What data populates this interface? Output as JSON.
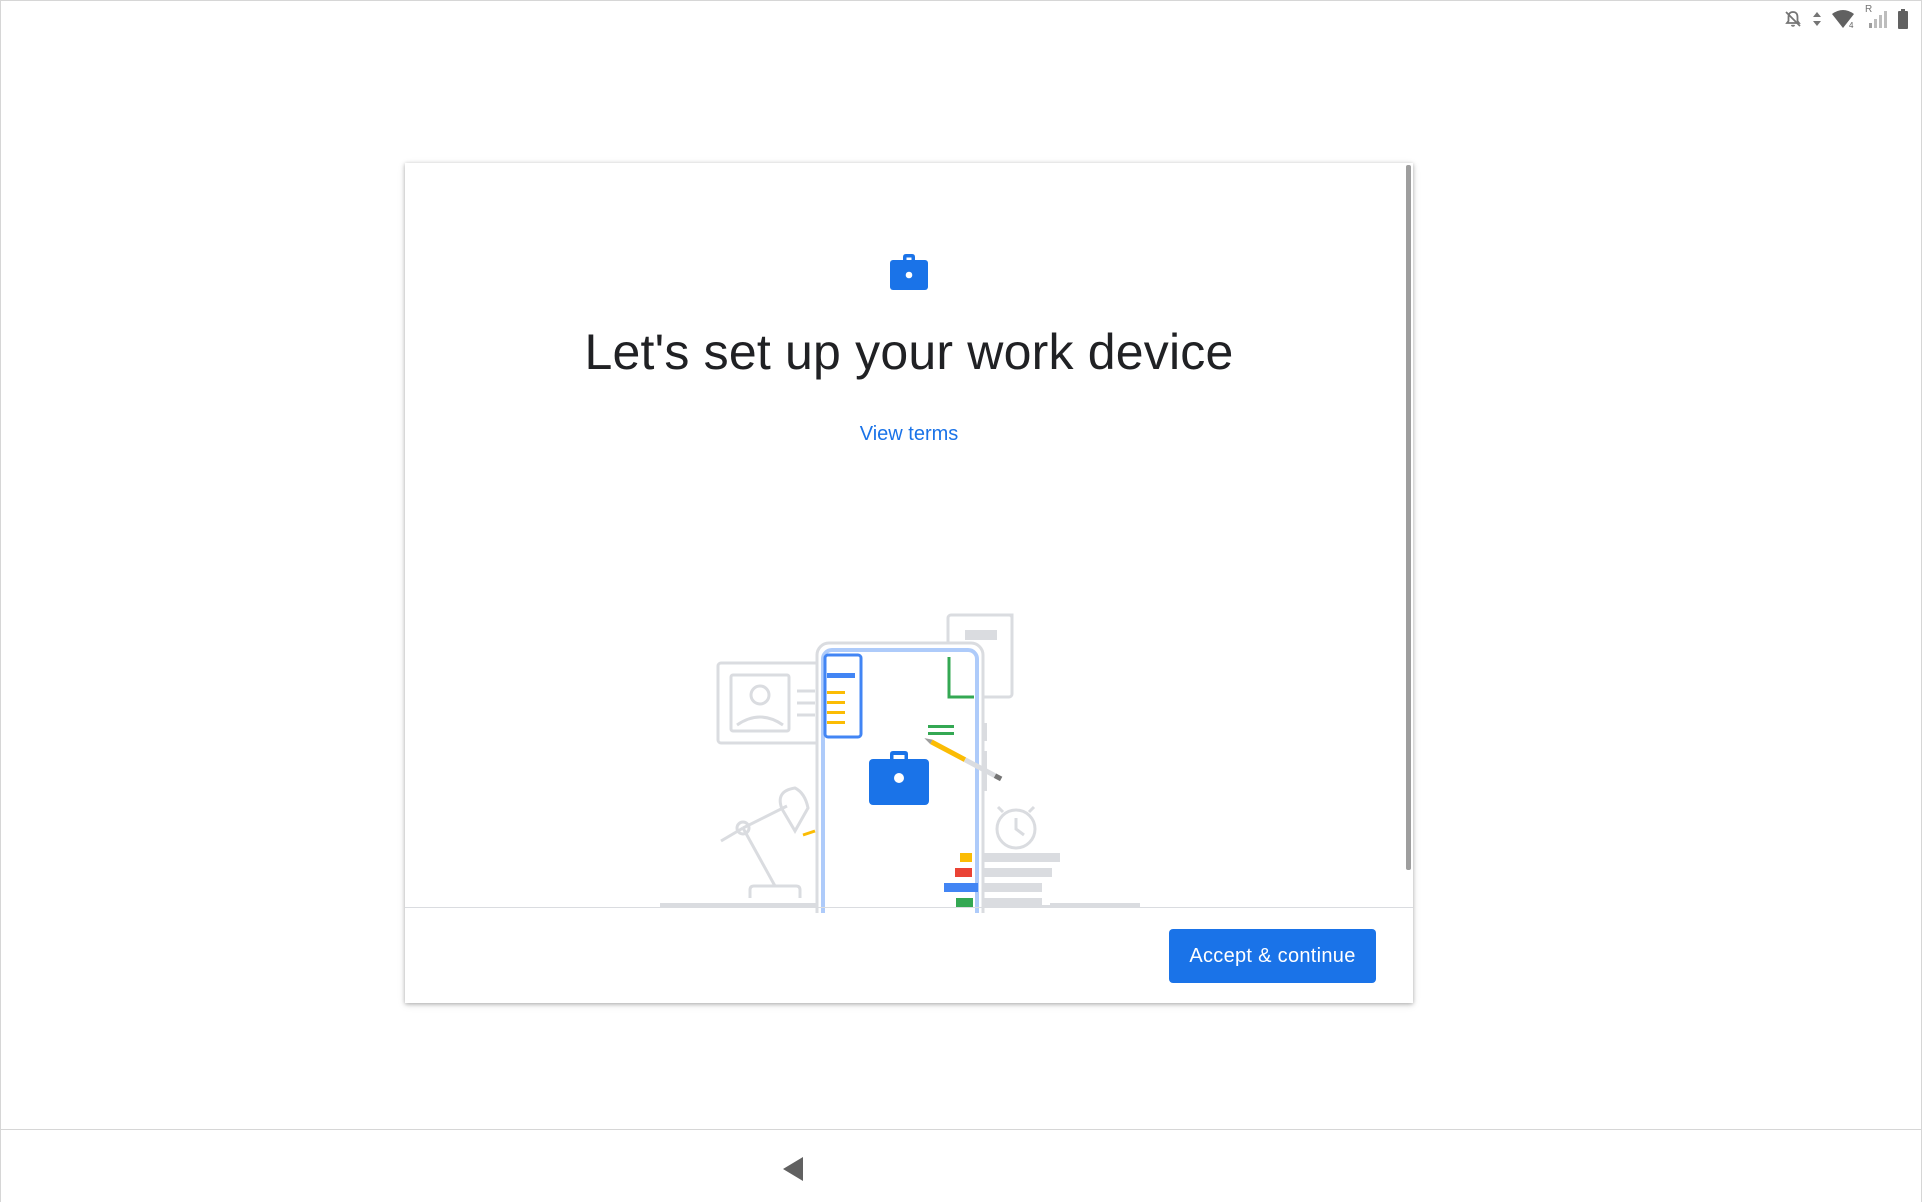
{
  "status_bar": {
    "icons": [
      "notifications-off-icon",
      "data-activity-icon",
      "wifi-icon",
      "signal-icon",
      "battery-icon"
    ],
    "roaming_indicator": "R"
  },
  "dialog": {
    "header_icon": "briefcase-icon",
    "title": "Let's set up your work device",
    "view_terms_label": "View terms",
    "illustration": "work-device-illustration",
    "accept_label": "Accept & continue"
  },
  "navigation": {
    "back_icon": "back-triangle-icon"
  },
  "colors": {
    "accent": "#1a73e8",
    "title_text": "#202124",
    "divider": "#dadce0",
    "illustration_gray": "#dadce0",
    "illustration_blue_light": "#aecbfa",
    "google_blue": "#4285f4",
    "google_red": "#ea4335",
    "google_yellow": "#fbbc04",
    "google_green": "#34a853"
  }
}
